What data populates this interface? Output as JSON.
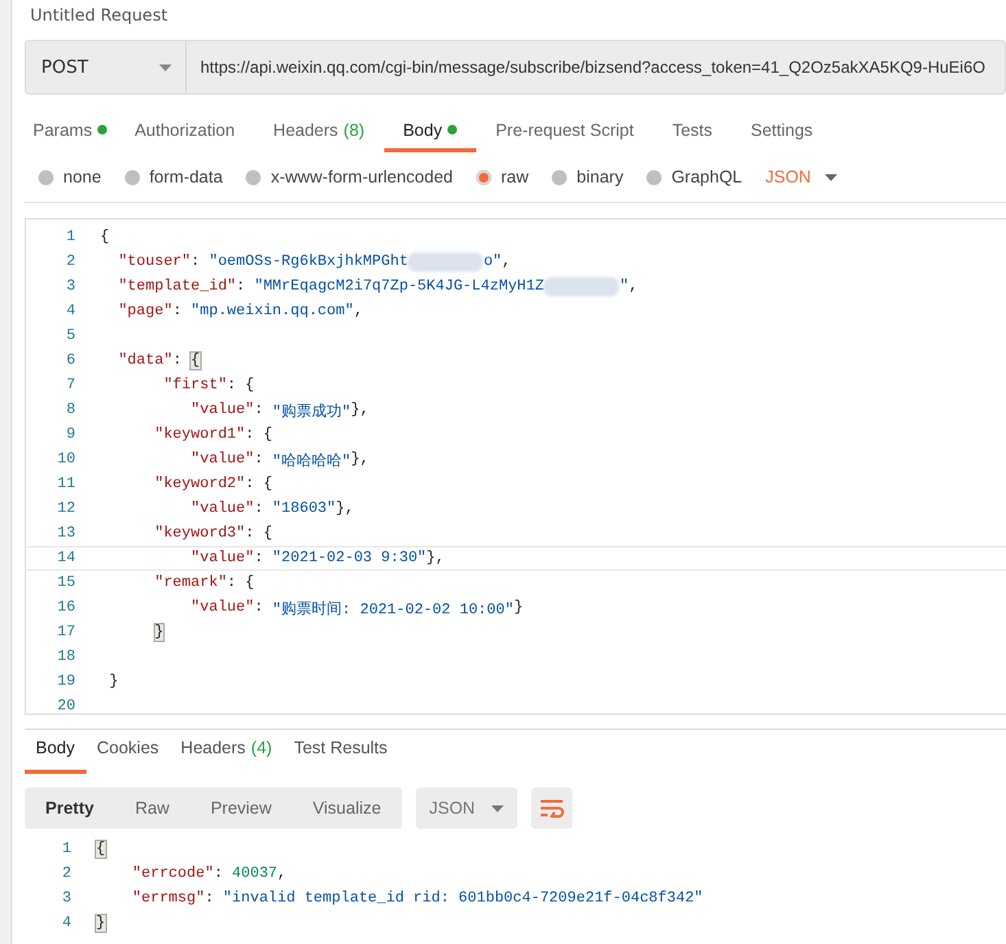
{
  "title": "Untitled Request",
  "request": {
    "method": "POST",
    "url": "https://api.weixin.qq.com/cgi-bin/message/subscribe/bizsend?access_token=41_Q2Oz5akXA5KQ9-HuEi6O"
  },
  "tabs": [
    {
      "label": "Params",
      "dot": true,
      "selected": false
    },
    {
      "label": "Authorization",
      "dot": false,
      "selected": false
    },
    {
      "label": "Headers",
      "dot": false,
      "count": "(8)",
      "selected": false
    },
    {
      "label": "Body",
      "dot": true,
      "selected": true
    },
    {
      "label": "Pre-request Script",
      "dot": false,
      "selected": false
    },
    {
      "label": "Tests",
      "dot": false,
      "selected": false
    },
    {
      "label": "Settings",
      "dot": false,
      "selected": false
    }
  ],
  "body_types": [
    {
      "label": "none",
      "selected": false
    },
    {
      "label": "form-data",
      "selected": false
    },
    {
      "label": "x-www-form-urlencoded",
      "selected": false
    },
    {
      "label": "raw",
      "selected": true
    },
    {
      "label": "binary",
      "selected": false
    },
    {
      "label": "GraphQL",
      "selected": false
    }
  ],
  "raw_format": "JSON",
  "editor": {
    "lines": [
      {
        "number": "1",
        "active": false,
        "tokens": [
          {
            "kind": "punct",
            "text": "{"
          }
        ]
      },
      {
        "number": "2",
        "active": false,
        "tokens": [
          {
            "kind": "key",
            "text": "  \"touser\""
          },
          {
            "kind": "punct",
            "text": ": "
          },
          {
            "kind": "str",
            "text": "\"oemOSs-Rg6kBxjhkMPGht"
          },
          {
            "kind": "redacted"
          },
          {
            "kind": "str",
            "text": "o\""
          },
          {
            "kind": "punct",
            "text": ","
          }
        ]
      },
      {
        "number": "3",
        "active": false,
        "tokens": [
          {
            "kind": "key",
            "text": "  \"template_id\""
          },
          {
            "kind": "punct",
            "text": ": "
          },
          {
            "kind": "str",
            "text": "\"MMrEqagcM2i7q7Zp-5K4JG-L4zMyH1Z"
          },
          {
            "kind": "redacted"
          },
          {
            "kind": "str",
            "text": "\""
          },
          {
            "kind": "punct",
            "text": ","
          }
        ]
      },
      {
        "number": "4",
        "active": false,
        "tokens": [
          {
            "kind": "key",
            "text": "  \"page\""
          },
          {
            "kind": "punct",
            "text": ": "
          },
          {
            "kind": "str",
            "text": "\"mp.weixin.qq.com\""
          },
          {
            "kind": "punct",
            "text": ","
          }
        ]
      },
      {
        "number": "5",
        "active": false
      },
      {
        "number": "6",
        "active": false,
        "tokens": [
          {
            "kind": "key",
            "text": "  \"data\""
          },
          {
            "kind": "punct",
            "text": ": "
          },
          {
            "kind": "match",
            "text": "{"
          }
        ]
      },
      {
        "number": "7",
        "active": false,
        "tokens": [
          {
            "kind": "key",
            "text": "       \"first\""
          },
          {
            "kind": "punct",
            "text": ": {"
          }
        ]
      },
      {
        "number": "8",
        "active": false,
        "tokens": [
          {
            "kind": "key",
            "text": "          \"value\""
          },
          {
            "kind": "punct",
            "text": ": "
          },
          {
            "kind": "str",
            "text": "\"购票成功\""
          },
          {
            "kind": "punct",
            "text": "},"
          }
        ]
      },
      {
        "number": "9",
        "active": false,
        "tokens": [
          {
            "kind": "key",
            "text": "      \"keyword1\""
          },
          {
            "kind": "punct",
            "text": ": {"
          }
        ]
      },
      {
        "number": "10",
        "active": false,
        "tokens": [
          {
            "kind": "key",
            "text": "          \"value\""
          },
          {
            "kind": "punct",
            "text": ": "
          },
          {
            "kind": "str",
            "text": "\"哈哈哈哈\""
          },
          {
            "kind": "punct",
            "text": "},"
          }
        ]
      },
      {
        "number": "11",
        "active": false,
        "tokens": [
          {
            "kind": "key",
            "text": "      \"keyword2\""
          },
          {
            "kind": "punct",
            "text": ": {"
          }
        ]
      },
      {
        "number": "12",
        "active": false,
        "tokens": [
          {
            "kind": "key",
            "text": "          \"value\""
          },
          {
            "kind": "punct",
            "text": ": "
          },
          {
            "kind": "str",
            "text": "\"18603\""
          },
          {
            "kind": "punct",
            "text": "},"
          }
        ]
      },
      {
        "number": "13",
        "active": false,
        "tokens": [
          {
            "kind": "key",
            "text": "      \"keyword3\""
          },
          {
            "kind": "punct",
            "text": ": {"
          }
        ]
      },
      {
        "number": "14",
        "active": true,
        "tokens": [
          {
            "kind": "key",
            "text": "          \"value\""
          },
          {
            "kind": "punct",
            "text": ": "
          },
          {
            "kind": "str",
            "text": "\"2021-02-03 9:30\""
          },
          {
            "kind": "punct",
            "text": "},"
          }
        ]
      },
      {
        "number": "15",
        "active": false,
        "tokens": [
          {
            "kind": "key",
            "text": "      \"remark\""
          },
          {
            "kind": "punct",
            "text": ": {"
          }
        ]
      },
      {
        "number": "16",
        "active": false,
        "tokens": [
          {
            "kind": "key",
            "text": "          \"value\""
          },
          {
            "kind": "punct",
            "text": ": "
          },
          {
            "kind": "str",
            "text": "\"购票时间: 2021-02-02 10:00\""
          },
          {
            "kind": "punct",
            "text": "}"
          }
        ]
      },
      {
        "number": "17",
        "active": false,
        "tokens": [
          {
            "kind": "match",
            "text": "      }"
          }
        ]
      },
      {
        "number": "18",
        "active": false
      },
      {
        "number": "19",
        "active": false,
        "tokens": [
          {
            "kind": "punct",
            "text": " }"
          }
        ]
      },
      {
        "number": "20",
        "active": false
      }
    ]
  },
  "response_tabs": [
    {
      "label": "Body",
      "selected": true
    },
    {
      "label": "Cookies",
      "selected": false
    },
    {
      "label": "Headers",
      "count": "(4)",
      "selected": false
    },
    {
      "label": "Test Results",
      "selected": false
    }
  ],
  "view_modes": [
    {
      "label": "Pretty",
      "selected": true
    },
    {
      "label": "Raw",
      "selected": false
    },
    {
      "label": "Preview",
      "selected": false
    },
    {
      "label": "Visualize",
      "selected": false
    }
  ],
  "response_format": "JSON",
  "response": {
    "lines": [
      {
        "number": "1",
        "tokens": [
          {
            "kind": "match",
            "text": "{"
          }
        ]
      },
      {
        "number": "2",
        "tokens": [
          {
            "kind": "key",
            "text": "    \"errcode\""
          },
          {
            "kind": "punct",
            "text": ": "
          },
          {
            "kind": "num",
            "text": "40037"
          },
          {
            "kind": "punct",
            "text": ","
          }
        ]
      },
      {
        "number": "3",
        "tokens": [
          {
            "kind": "key",
            "text": "    \"errmsg\""
          },
          {
            "kind": "punct",
            "text": ": "
          },
          {
            "kind": "str",
            "text": "\"invalid template_id rid: 601bb0c4-7209e21f-04c8f342\""
          }
        ]
      },
      {
        "number": "4",
        "tokens": [
          {
            "kind": "match",
            "text": "}"
          }
        ]
      }
    ]
  }
}
